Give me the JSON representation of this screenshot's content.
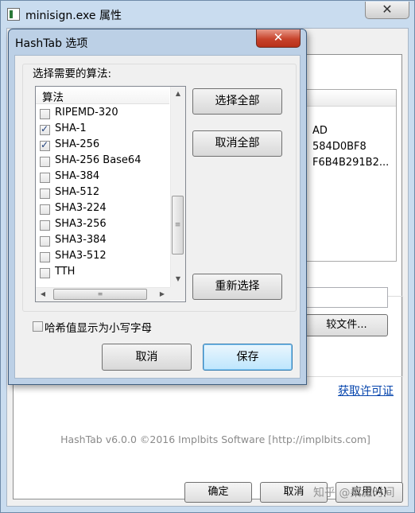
{
  "background_window": {
    "title": "minisign.exe 属性",
    "close_glyph": "✕",
    "hashes": [
      "AD",
      "584D0BF8",
      "F6B4B291B2..."
    ],
    "compare_button": "较文件...",
    "license_link": "获取许可证",
    "footer": "HashTab v6.0.0 ©2016 Implbits Software [http://implbits.com]",
    "buttons": {
      "ok": "确定",
      "cancel": "取消",
      "apply": "应用(A)"
    },
    "watermark": "知乎 @柔滤时间"
  },
  "dialog": {
    "title": "HashTab 选项",
    "close_glyph": "✕",
    "group_label": "选择需要的算法:",
    "list_header": "算法",
    "algorithms": [
      {
        "label": "RIPEMD-320",
        "checked": false
      },
      {
        "label": "SHA-1",
        "checked": true
      },
      {
        "label": "SHA-256",
        "checked": true
      },
      {
        "label": "SHA-256 Base64",
        "checked": false
      },
      {
        "label": "SHA-384",
        "checked": false
      },
      {
        "label": "SHA-512",
        "checked": false
      },
      {
        "label": "SHA3-224",
        "checked": false
      },
      {
        "label": "SHA3-256",
        "checked": false
      },
      {
        "label": "SHA3-384",
        "checked": false
      },
      {
        "label": "SHA3-512",
        "checked": false
      },
      {
        "label": "TTH",
        "checked": false
      }
    ],
    "select_all": "选择全部",
    "deselect_all": "取消全部",
    "reselect": "重新选择",
    "lowercase_label": "哈希值显示为小写字母",
    "lowercase_checked": false,
    "cancel": "取消",
    "save": "保存",
    "scroll_up_glyph": "▲",
    "scroll_down_glyph": "▼",
    "scroll_left_glyph": "◀",
    "scroll_right_glyph": "▶",
    "thumb_grip_glyph": "≡"
  }
}
